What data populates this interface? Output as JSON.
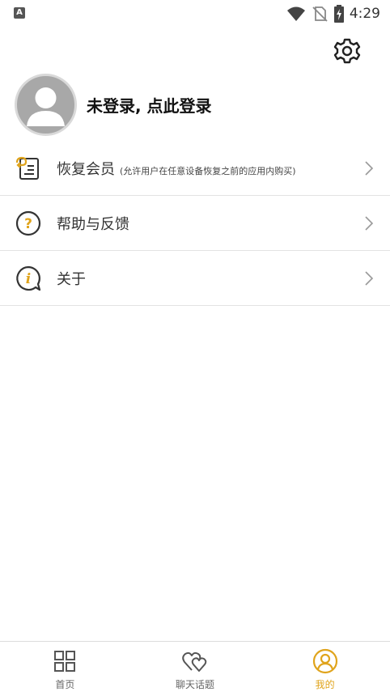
{
  "status_bar": {
    "notification_icon": "A",
    "time": "4:29",
    "icons": [
      "wifi-icon",
      "no-sim-icon",
      "battery-charging-icon"
    ]
  },
  "header": {
    "settings_icon": "gear-icon"
  },
  "profile": {
    "login_prompt": "未登录, 点此登录",
    "avatar_icon": "default-avatar-icon"
  },
  "menu": {
    "items": [
      {
        "label": "恢复会员",
        "sub": "(允许用户在任意设备恢复之前的应用内购买)",
        "icon": "restore-membership-icon"
      },
      {
        "label": "帮助与反馈",
        "icon": "question-circle-icon"
      },
      {
        "label": "关于",
        "icon": "info-bubble-icon"
      }
    ]
  },
  "bottom_nav": {
    "items": [
      {
        "label": "首页",
        "icon": "grid-icon",
        "active": false
      },
      {
        "label": "聊天话题",
        "icon": "hearts-icon",
        "active": false
      },
      {
        "label": "我的",
        "icon": "user-circle-icon",
        "active": true
      }
    ]
  },
  "colors": {
    "accent": "#e0a41c",
    "icon_dark": "#333333",
    "divider": "#e3e3e3"
  }
}
